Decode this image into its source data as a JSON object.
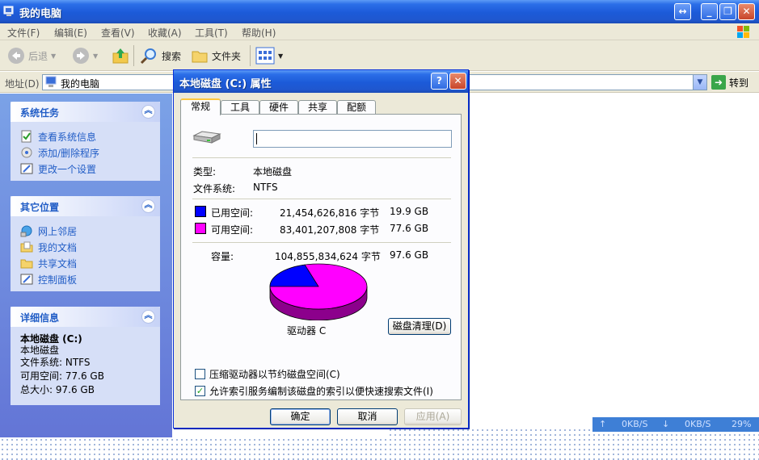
{
  "window": {
    "title": "我的电脑",
    "ctrl_restore_glyph": "↔",
    "ctrl_min_glyph": "_",
    "ctrl_max_glyph": "❐",
    "ctrl_close_glyph": "✕"
  },
  "menu": [
    "文件(F)",
    "编辑(E)",
    "查看(V)",
    "收藏(A)",
    "工具(T)",
    "帮助(H)"
  ],
  "toolbar": {
    "back": "后退",
    "search": "搜索",
    "folders": "文件夹"
  },
  "address": {
    "label": "地址(D)",
    "value": "我的电脑",
    "go": "转到"
  },
  "left": {
    "system_tasks": {
      "title": "系统任务",
      "items": [
        "查看系统信息",
        "添加/删除程序",
        "更改一个设置"
      ]
    },
    "other_places": {
      "title": "其它位置",
      "items": [
        "网上邻居",
        "我的文档",
        "共享文档",
        "控制面板"
      ]
    },
    "details": {
      "title": "详细信息",
      "name": "本地磁盘 (C:)",
      "kind": "本地磁盘",
      "fs": "文件系统: NTFS",
      "free": "可用空间: 77.6 GB",
      "total": "总大小: 97.6 GB"
    }
  },
  "dialog": {
    "title": "本地磁盘 (C:) 属性",
    "help_glyph": "?",
    "close_glyph": "✕",
    "tabs": [
      "常规",
      "工具",
      "硬件",
      "共享",
      "配额"
    ],
    "type_label": "类型:",
    "type_value": "本地磁盘",
    "fs_label": "文件系统:",
    "fs_value": "NTFS",
    "used_label": "已用空间:",
    "used_bytes": "21,454,626,816 字节",
    "used_gb": "19.9 GB",
    "free_label": "可用空间:",
    "free_bytes": "83,401,207,808 字节",
    "free_gb": "77.6 GB",
    "cap_label": "容量:",
    "cap_bytes": "104,855,834,624 字节",
    "cap_gb": "97.6 GB",
    "drive_label": "驱动器 C",
    "cleanup": "磁盘清理(D)",
    "compress_label": "压缩驱动器以节约磁盘空间(C)",
    "compress_checked": false,
    "index_label": "允许索引服务编制该磁盘的索引以便快速搜索文件(I)",
    "index_checked": true,
    "index_mark": "✓",
    "ok": "确定",
    "cancel": "取消",
    "apply": "应用(A)",
    "used_color": "#0000ff",
    "free_color": "#ff00ff",
    "used_fraction": 0.2046
  },
  "netbar": {
    "up": "0KB/S",
    "down": "0KB/S",
    "pct": "29%"
  }
}
